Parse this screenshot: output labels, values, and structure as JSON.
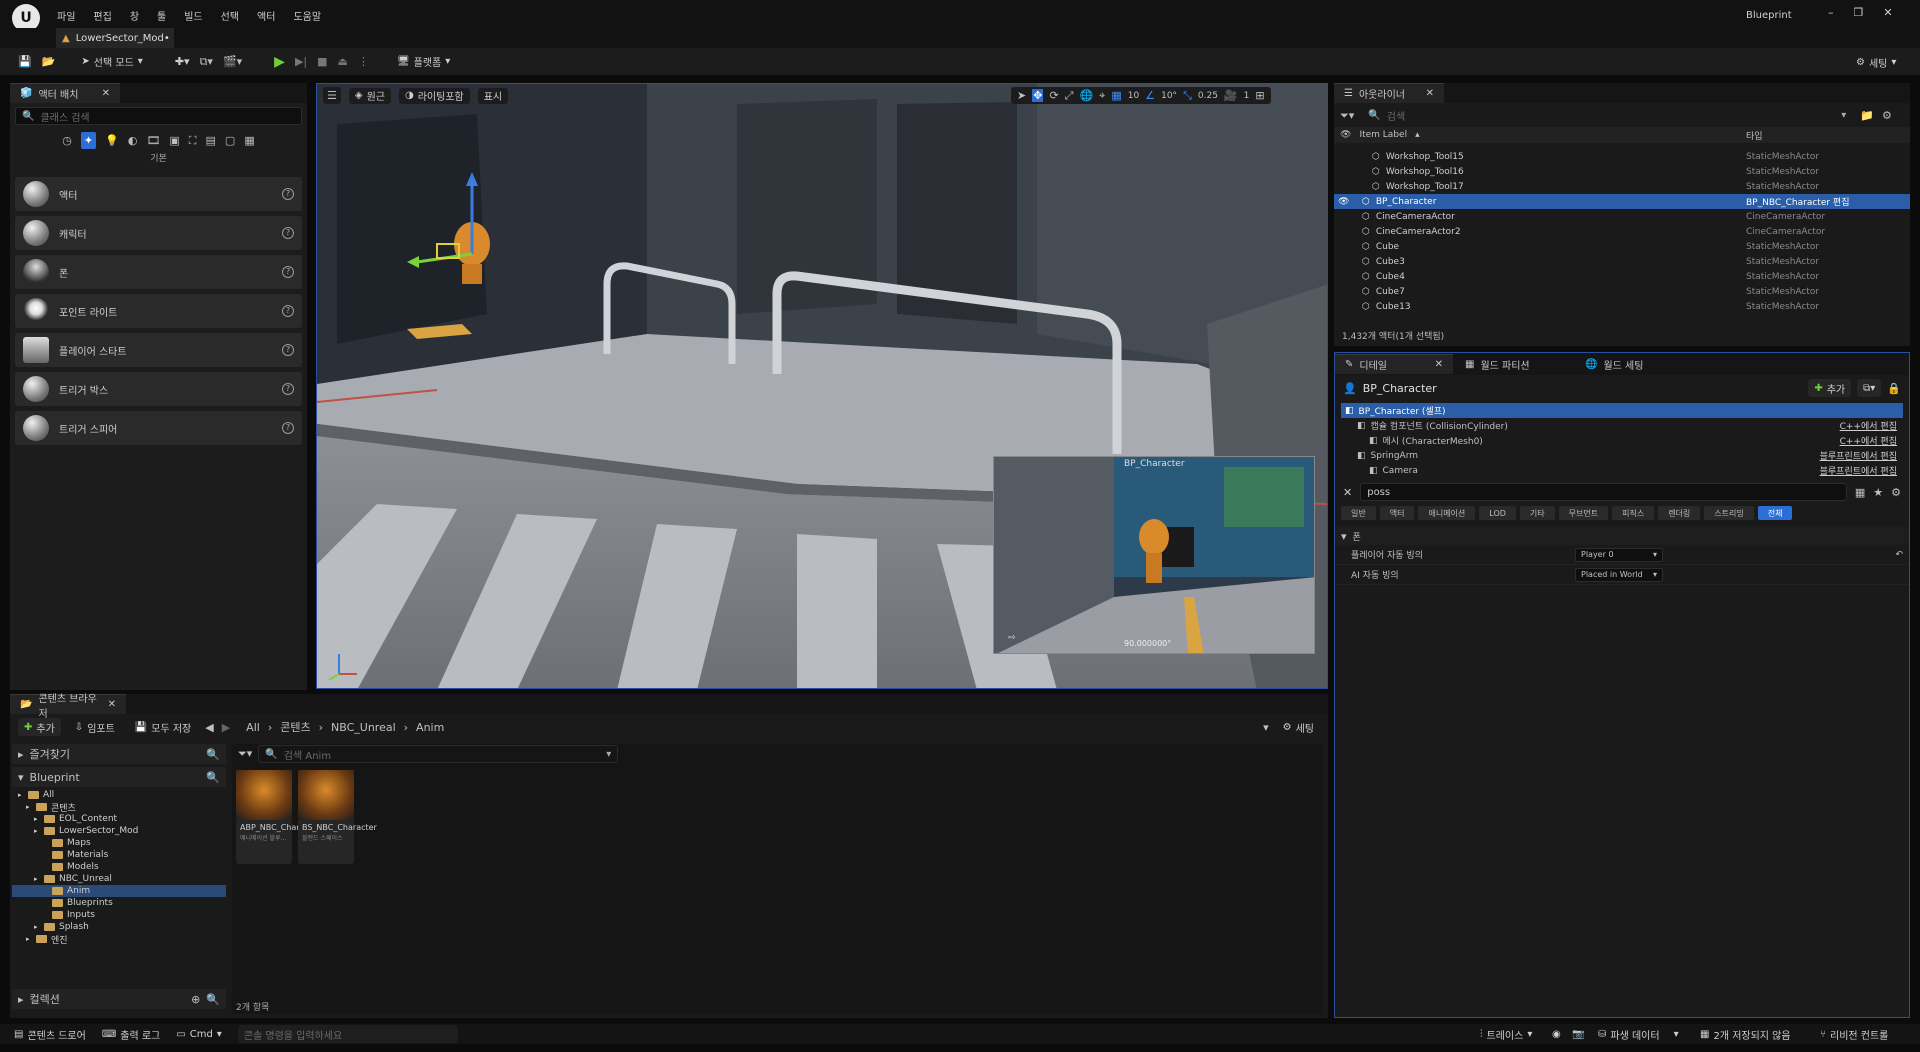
{
  "titlebar": {
    "tab_title": "LowerSector_Mod•",
    "window_title": "Blueprint"
  },
  "menu": [
    "파일",
    "편집",
    "창",
    "툴",
    "빌드",
    "선택",
    "액터",
    "도움말"
  ],
  "toolbar": {
    "select_mode": "선택 모드",
    "platform": "플랫폼",
    "settings": "세팅"
  },
  "place_actors": {
    "tab": "액터 배치",
    "search_placeholder": "클래스 검색",
    "section": "기본",
    "items": [
      "액터",
      "캐릭터",
      "폰",
      "포인트 라이트",
      "플레이어 스타트",
      "트리거 박스",
      "트리거 스피어"
    ]
  },
  "viewport": {
    "perspective": "원근",
    "lighting": "라이팅포함",
    "show": "표시",
    "grid_size": "10",
    "angle": "10°",
    "scale": "0.25",
    "camera_speed": "1",
    "pip_label": "BP_Character",
    "pip_value": "90.000000°"
  },
  "outliner": {
    "tab": "아웃라이너",
    "search_placeholder": "검색",
    "col_label": "Item Label",
    "col_type": "타입",
    "rows": [
      {
        "name": "Workshop_Tool15",
        "type": "StaticMeshActor",
        "indent": 2
      },
      {
        "name": "Workshop_Tool16",
        "type": "StaticMeshActor",
        "indent": 2
      },
      {
        "name": "Workshop_Tool17",
        "type": "StaticMeshActor",
        "indent": 2
      },
      {
        "name": "BP_Character",
        "type": "BP_NBC_Character 편집",
        "indent": 1,
        "selected": true
      },
      {
        "name": "CineCameraActor",
        "type": "CineCameraActor",
        "indent": 1
      },
      {
        "name": "CineCameraActor2",
        "type": "CineCameraActor",
        "indent": 1
      },
      {
        "name": "Cube",
        "type": "StaticMeshActor",
        "indent": 1
      },
      {
        "name": "Cube3",
        "type": "StaticMeshActor",
        "indent": 1
      },
      {
        "name": "Cube4",
        "type": "StaticMeshActor",
        "indent": 1
      },
      {
        "name": "Cube7",
        "type": "StaticMeshActor",
        "indent": 1
      },
      {
        "name": "Cube13",
        "type": "StaticMeshActor",
        "indent": 1
      }
    ],
    "count": "1,432개 액터(1개 선택됨)"
  },
  "details": {
    "tabs": [
      "디테일",
      "월드 파티션",
      "월드 세팅"
    ],
    "actor_name": "BP_Character",
    "add_button": "추가",
    "components": [
      {
        "name": "BP_Character (셀프)",
        "action": "",
        "indent": 0,
        "selected": true
      },
      {
        "name": "캡슐 컴포넌트 (CollisionCylinder)",
        "action": "C++에서 편집",
        "indent": 1
      },
      {
        "name": "메시 (CharacterMesh0)",
        "action": "C++에서 편집",
        "indent": 2
      },
      {
        "name": "SpringArm",
        "action": "블루프린트에서 편집",
        "indent": 1
      },
      {
        "name": "Camera",
        "action": "블루프린트에서 편집",
        "indent": 2
      }
    ],
    "search_value": "poss",
    "categories": [
      "일반",
      "액터",
      "애니메이션",
      "LOD",
      "기타",
      "무브먼트",
      "피직스",
      "렌더링",
      "스트리밍",
      "전체"
    ],
    "section": "폰",
    "props": [
      {
        "label": "플레이어 자동 빙의",
        "value": "Player 0"
      },
      {
        "label": "AI 자동 빙의",
        "value": "Placed in World"
      }
    ]
  },
  "content_browser": {
    "tab": "콘텐츠 브라우저",
    "add": "추가",
    "import": "임포트",
    "save_all": "모두 저장",
    "path": [
      "All",
      "콘텐츠",
      "NBC_Unreal",
      "Anim"
    ],
    "settings": "세팅",
    "favorites": "즐겨찾기",
    "root": "Blueprint",
    "search_placeholder": "검색 Anim",
    "tree": [
      {
        "name": "All",
        "indent": 0
      },
      {
        "name": "콘텐츠",
        "indent": 1
      },
      {
        "name": "EOL_Content",
        "indent": 2
      },
      {
        "name": "LowerSector_Mod",
        "indent": 2
      },
      {
        "name": "Maps",
        "indent": 3
      },
      {
        "name": "Materials",
        "indent": 3
      },
      {
        "name": "Models",
        "indent": 3
      },
      {
        "name": "NBC_Unreal",
        "indent": 2
      },
      {
        "name": "Anim",
        "indent": 3,
        "selected": true
      },
      {
        "name": "Blueprints",
        "indent": 3
      },
      {
        "name": "Inputs",
        "indent": 3
      },
      {
        "name": "Splash",
        "indent": 2
      },
      {
        "name": "엔진",
        "indent": 1
      }
    ],
    "collections": "컬렉션",
    "assets": [
      {
        "name": "ABP_NBC_Character",
        "sub": "애니메이션 블루..."
      },
      {
        "name": "BS_NBC_Character",
        "sub": "블렌드 스페이스"
      }
    ],
    "item_count": "2개 항목"
  },
  "statusbar": {
    "content_drawer": "콘텐츠 드로어",
    "output_log": "출력 로그",
    "cmd": "Cmd",
    "console_placeholder": "콘솔 명령을 입력하세요",
    "trace": "트레이스",
    "derived_data": "파생 데이터",
    "unsaved": "2개 저장되지 않음",
    "revision": "리비전 컨트롤"
  }
}
